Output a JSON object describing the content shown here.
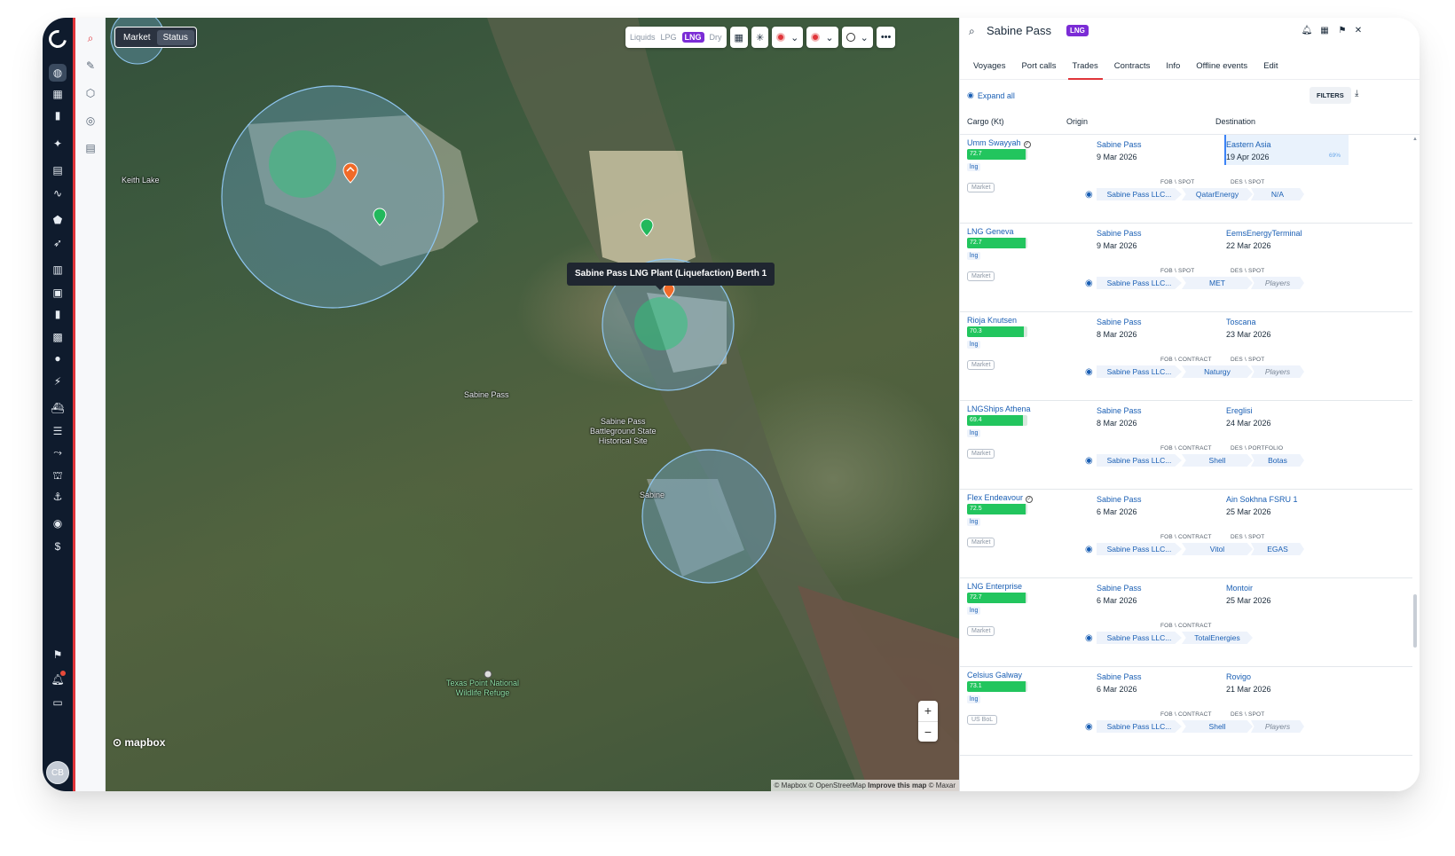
{
  "app": {
    "user_initials": "CB",
    "accent_color": "#e0353a",
    "lng_color": "#7b2cd6",
    "rail_icons": [
      "globe-icon",
      "grid-icon",
      "bookmark-icon",
      "sparkle-icon",
      "ship-database-icon",
      "pulse-icon",
      "shield-icon",
      "rocket-icon",
      "document-icon",
      "oil-icon",
      "bar-chart-icon",
      "lng-icon",
      "drop-icon",
      "lightning-icon",
      "vessel-icon",
      "list-icon",
      "route-icon",
      "port-icon",
      "anchor-icon",
      "eye-icon",
      "dollar-icon",
      "flag-icon",
      "bell-icon",
      "chat-icon"
    ],
    "tool_icons": [
      "search-icon",
      "edit-icon",
      "polygon-icon",
      "radar-icon",
      "layers-icon"
    ]
  },
  "map": {
    "view_toggle": {
      "options": [
        "Market",
        "Status"
      ],
      "selected": "Status"
    },
    "commodity": {
      "options": [
        "Liquids",
        "LPG",
        "LNG",
        "Dry"
      ],
      "selected": "LNG"
    },
    "tooltip": "Sabine Pass LNG Plant (Liquefaction) Berth 1",
    "labels": {
      "keith_lake": "Keith Lake",
      "sabine_pass": "Sabine Pass",
      "battleground": [
        "Sabine Pass",
        "Battleground State",
        "Historical Site"
      ],
      "sabine": "Sabine",
      "texas_point": [
        "Texas Point National",
        "Wildlife Refuge"
      ]
    },
    "zoom_in": "+",
    "zoom_out": "−",
    "logo": "mapbox",
    "attribution": {
      "text": "© Mapbox © OpenStreetMap",
      "link": "Improve this map",
      "suffix": "© Maxar"
    }
  },
  "panel": {
    "title": "Sabine Pass",
    "badge": "LNG",
    "tabs": [
      "Voyages",
      "Port calls",
      "Trades",
      "Contracts",
      "Info",
      "Offline events",
      "Edit"
    ],
    "active_tab": "Trades",
    "expand_all": "Expand all",
    "filters": "FILTERS",
    "columns": {
      "cargo": "Cargo (Kt)",
      "origin": "Origin",
      "destination": "Destination"
    },
    "rows": [
      {
        "vessel": "Umm Swayyah",
        "verified": true,
        "cargo": "72.7",
        "fill": 0.97,
        "product": "lng",
        "tag": "Market",
        "origin": "Sabine Pass",
        "origin_date": "9 Mar 2026",
        "destination": "Eastern Asia",
        "destination_date": "19 Apr 2026",
        "dest_pct": "69%",
        "term_origin": "FOB \\ SPOT",
        "term_dest": "DES \\ SPOT",
        "seller": "Sabine Pass LLC...",
        "buyer": "QatarEnergy",
        "end": "N/A",
        "end_muted": false
      },
      {
        "vessel": "LNG Geneva",
        "verified": false,
        "cargo": "72.7",
        "fill": 0.97,
        "product": "lng",
        "tag": "Market",
        "origin": "Sabine Pass",
        "origin_date": "9 Mar 2026",
        "destination": "EemsEnergyTerminal",
        "destination_date": "22 Mar 2026",
        "dest_pct": "",
        "term_origin": "FOB \\ SPOT",
        "term_dest": "DES \\ SPOT",
        "seller": "Sabine Pass LLC...",
        "buyer": "MET",
        "end": "Players",
        "end_muted": true
      },
      {
        "vessel": "Rioja Knutsen",
        "verified": false,
        "cargo": "70.3",
        "fill": 0.94,
        "product": "lng",
        "tag": "Market",
        "origin": "Sabine Pass",
        "origin_date": "8 Mar 2026",
        "destination": "Toscana",
        "destination_date": "23 Mar 2026",
        "dest_pct": "",
        "term_origin": "FOB \\ CONTRACT",
        "term_dest": "DES \\ SPOT",
        "seller": "Sabine Pass LLC...",
        "buyer": "Naturgy",
        "end": "Players",
        "end_muted": true
      },
      {
        "vessel": "LNGShips Athena",
        "verified": false,
        "cargo": "69.4",
        "fill": 0.92,
        "product": "lng",
        "tag": "Market",
        "origin": "Sabine Pass",
        "origin_date": "8 Mar 2026",
        "destination": "Ereglisi",
        "destination_date": "24 Mar 2026",
        "dest_pct": "",
        "term_origin": "FOB \\ CONTRACT",
        "term_dest": "DES \\ PORTFOLIO",
        "seller": "Sabine Pass LLC...",
        "buyer": "Shell",
        "end": "Botas",
        "end_muted": false
      },
      {
        "vessel": "Flex Endeavour",
        "verified": true,
        "cargo": "72.5",
        "fill": 0.97,
        "product": "lng",
        "tag": "Market",
        "origin": "Sabine Pass",
        "origin_date": "6 Mar 2026",
        "destination": "Ain Sokhna FSRU 1",
        "destination_date": "25 Mar 2026",
        "dest_pct": "",
        "term_origin": "FOB \\ CONTRACT",
        "term_dest": "DES \\ SPOT",
        "seller": "Sabine Pass LLC...",
        "buyer": "Vitol",
        "end": "EGAS",
        "end_muted": false
      },
      {
        "vessel": "LNG Enterprise",
        "verified": false,
        "cargo": "72.7",
        "fill": 0.97,
        "product": "lng",
        "tag": "Market",
        "origin": "Sabine Pass",
        "origin_date": "6 Mar 2026",
        "destination": "Montoir",
        "destination_date": "25 Mar 2026",
        "dest_pct": "",
        "term_origin": "FOB \\ CONTRACT",
        "term_dest": "",
        "seller": "Sabine Pass LLC...",
        "buyer": "TotalEnergies",
        "end": "",
        "end_muted": false
      },
      {
        "vessel": "Celsius Galway",
        "verified": false,
        "cargo": "73.1",
        "fill": 0.97,
        "product": "lng",
        "tag": "US BoL",
        "origin": "Sabine Pass",
        "origin_date": "6 Mar 2026",
        "destination": "Rovigo",
        "destination_date": "21 Mar 2026",
        "dest_pct": "",
        "term_origin": "FOB \\ CONTRACT",
        "term_dest": "DES \\ SPOT",
        "seller": "Sabine Pass LLC...",
        "buyer": "Shell",
        "end": "Players",
        "end_muted": true
      }
    ]
  }
}
